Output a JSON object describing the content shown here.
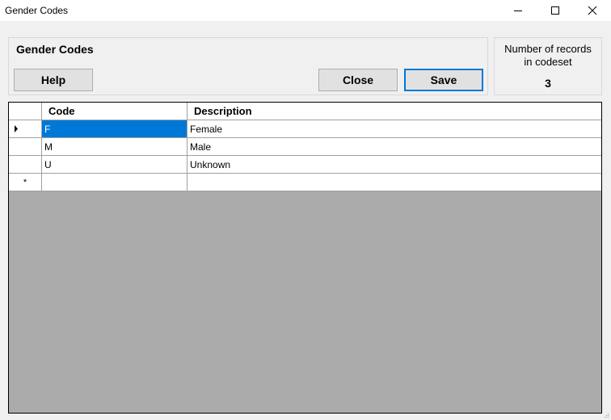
{
  "window": {
    "title": "Gender Codes",
    "controls": [
      "minimize-icon",
      "maximize-icon",
      "close-icon"
    ]
  },
  "panel": {
    "title": "Gender Codes",
    "help_label": "Help",
    "close_label": "Close",
    "save_label": "Save"
  },
  "record_count": {
    "label_line1": "Number of records",
    "label_line2": "in codeset",
    "value": "3"
  },
  "grid": {
    "columns": [
      "Code",
      "Description"
    ],
    "rows": [
      {
        "code": "F",
        "description": "Female",
        "current": true
      },
      {
        "code": "M",
        "description": "Male"
      },
      {
        "code": "U",
        "description": "Unknown"
      }
    ],
    "new_row_marker": "*"
  },
  "colors": {
    "selection": "#0078d7",
    "grid_background": "#ababab",
    "window_background": "#f0f0f0"
  }
}
